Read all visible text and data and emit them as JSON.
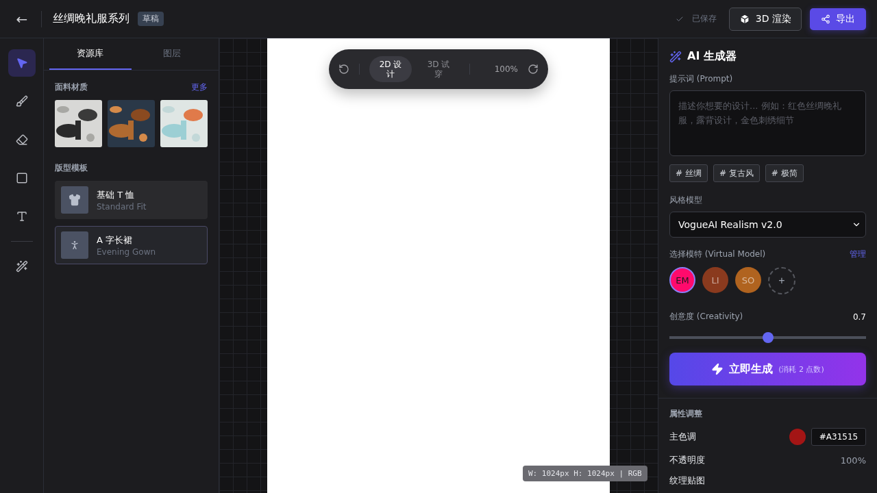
{
  "header": {
    "back": "←",
    "title": "丝绸晚礼服系列",
    "badge": "草稿",
    "saved": "已保存",
    "render_button": "3D 渲染",
    "export_button": "导出"
  },
  "tools": [
    {
      "kind": "select",
      "selected": true
    },
    {
      "kind": "brush",
      "selected": false
    },
    {
      "kind": "eraser",
      "selected": false
    },
    {
      "kind": "rect",
      "selected": false
    },
    {
      "kind": "text",
      "selected": false
    },
    {
      "kind": "wand",
      "selected": false
    }
  ],
  "side_tabs": [
    {
      "label": "资源库",
      "selected": true
    },
    {
      "label": "图层",
      "selected": false
    }
  ],
  "fabrics": {
    "title": "面料材质",
    "more": "更多"
  },
  "templates": {
    "title": "版型模板",
    "items": [
      {
        "kind": "tshirt",
        "name": "基础 T 恤",
        "sub": "Standard Fit",
        "selected": false
      },
      {
        "kind": "gown",
        "name": "A 字长裙",
        "sub": "Evening Gown",
        "selected": true
      }
    ]
  },
  "canvas_toolbar": {
    "modes": [
      {
        "label": "2D 设计",
        "selected": true
      },
      {
        "label": "3D 试穿",
        "selected": false
      }
    ],
    "zoom": "100%"
  },
  "canvas_info": "W: 1024px H: 1024px | RGB",
  "ai": {
    "title": "AI 生成器",
    "prompt_label": "提示词 (Prompt)",
    "prompt_placeholder": "描述你想要的设计... 例如：红色丝绸晚礼服，露背设计，金色刺绣细节",
    "tags": [
      "# 丝绸",
      "# 复古风",
      "# 极简"
    ],
    "style_label": "风格模型",
    "style_value": "VogueAI Realism v2.0",
    "model_label": "选择模特 (Virtual Model)",
    "manage": "管理",
    "models": [
      {
        "initials": "EM",
        "color": "#ff0a6c",
        "selected": true
      },
      {
        "initials": "LI",
        "color": "#8a3a1e",
        "selected": false
      },
      {
        "initials": "SO",
        "color": "#b0631f",
        "selected": false
      }
    ],
    "add_model": "+",
    "creativity_label": "创意度 (Creativity)",
    "creativity_reading": "0.7",
    "creativity_slider": {
      "level": 0.5
    },
    "generate": "立即生成",
    "generate_cost": "(消耗 2 点数)"
  },
  "properties": {
    "title": "属性调整",
    "rows": [
      {
        "kind": "color",
        "label": "主色调",
        "color": "#a31515",
        "value": "#A31515"
      },
      {
        "kind": "value",
        "label": "不透明度",
        "value": "100%"
      },
      {
        "kind": "label",
        "label": "纹理贴图"
      }
    ]
  }
}
